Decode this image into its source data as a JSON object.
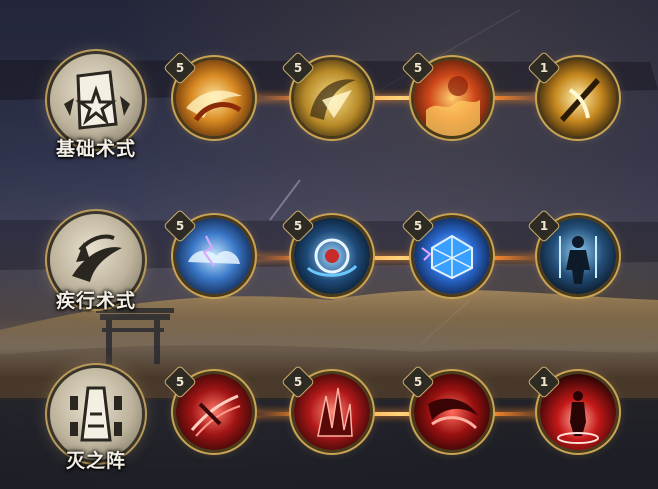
{
  "categories": [
    {
      "label": "基础术式",
      "emblem_icon": "scroll-star-icon",
      "skills": [
        {
          "icon": "flame-swirl-icon",
          "level": "5",
          "theme": "gold"
        },
        {
          "icon": "golden-slash-icon",
          "level": "5",
          "theme": "gold"
        },
        {
          "icon": "fire-wave-icon",
          "level": "5",
          "theme": "gold"
        },
        {
          "icon": "sword-strike-icon",
          "level": "1",
          "theme": "gold"
        }
      ]
    },
    {
      "label": "疾行术式",
      "emblem_icon": "wind-swirl-icon",
      "skills": [
        {
          "icon": "storm-cloud-icon",
          "level": "5",
          "theme": "blue"
        },
        {
          "icon": "vortex-orb-icon",
          "level": "5",
          "theme": "blue"
        },
        {
          "icon": "lightning-cube-icon",
          "level": "5",
          "theme": "blue"
        },
        {
          "icon": "warrior-silhouette-icon",
          "level": "1",
          "theme": "blue"
        }
      ]
    },
    {
      "label": "灭之阵",
      "emblem_icon": "tower-formation-icon",
      "skills": [
        {
          "icon": "red-claw-slash-icon",
          "level": "5",
          "theme": "red"
        },
        {
          "icon": "red-crystal-spike-icon",
          "level": "5",
          "theme": "red"
        },
        {
          "icon": "red-crescent-icon",
          "level": "5",
          "theme": "red"
        },
        {
          "icon": "red-figure-aura-icon",
          "level": "1",
          "theme": "red"
        }
      ]
    }
  ],
  "colors": {
    "gold_theme": "#d99a2b",
    "blue_theme": "#3b8ed6",
    "red_theme": "#c42a24",
    "link_glow": "#ff8a2a",
    "frame": "#c9a454"
  }
}
